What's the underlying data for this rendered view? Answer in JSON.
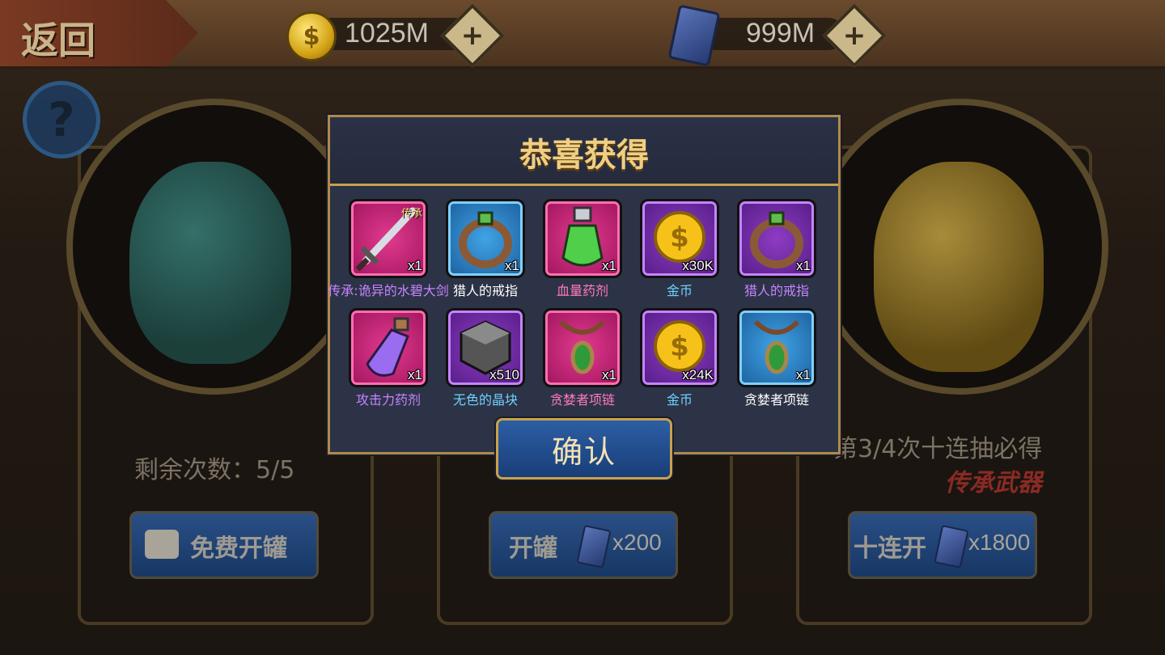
{
  "topbar": {
    "back_label": "返回",
    "gold_value": "1025M",
    "card_value": "999M",
    "coin_symbol": "$"
  },
  "help": {
    "symbol": "?"
  },
  "panels": {
    "left": {
      "remaining_text": "剩余次数：5/5",
      "button_label": "免费开罐"
    },
    "middle": {
      "button_label": "开罐",
      "cost": "x200"
    },
    "right": {
      "hint_text": "第3/4次十连抽必得",
      "legend_text": "传承武器",
      "button_label": "十连开",
      "cost": "x1800"
    }
  },
  "modal": {
    "title": "恭喜获得",
    "confirm_label": "确认",
    "items": [
      {
        "name": "传承:诡异的水碧大剑",
        "qty": "x1",
        "tag": "传承",
        "rarity": "pink",
        "icon": "sword-icon",
        "name_color": "#c584ff"
      },
      {
        "name": "猎人的戒指",
        "qty": "x1",
        "tag": "",
        "rarity": "blue",
        "icon": "ring-icon",
        "name_color": "#ffffff"
      },
      {
        "name": "血量药剂",
        "qty": "x1",
        "tag": "",
        "rarity": "pink",
        "icon": "green-potion-icon",
        "name_color": "#ff7ac0"
      },
      {
        "name": "金币",
        "qty": "x30K",
        "tag": "",
        "rarity": "purple",
        "icon": "gold-coin-icon",
        "name_color": "#6fd2ff"
      },
      {
        "name": "猎人的戒指",
        "qty": "x1",
        "tag": "",
        "rarity": "purple",
        "icon": "ring-icon",
        "name_color": "#c584ff"
      },
      {
        "name": "攻击力药剂",
        "qty": "x1",
        "tag": "",
        "rarity": "pink",
        "icon": "purple-potion-icon",
        "name_color": "#c584ff"
      },
      {
        "name": "无色的晶块",
        "qty": "x510",
        "tag": "",
        "rarity": "purple",
        "icon": "crystal-cube-icon",
        "name_color": "#6fd2ff"
      },
      {
        "name": "贪婪者项链",
        "qty": "x1",
        "tag": "",
        "rarity": "pink",
        "icon": "necklace-icon",
        "name_color": "#ff7ac0"
      },
      {
        "name": "金币",
        "qty": "x24K",
        "tag": "",
        "rarity": "purple",
        "icon": "gold-coin-icon",
        "name_color": "#6fd2ff"
      },
      {
        "name": "贪婪者项链",
        "qty": "x1",
        "tag": "",
        "rarity": "blue",
        "icon": "necklace-icon",
        "name_color": "#ffffff"
      }
    ]
  }
}
